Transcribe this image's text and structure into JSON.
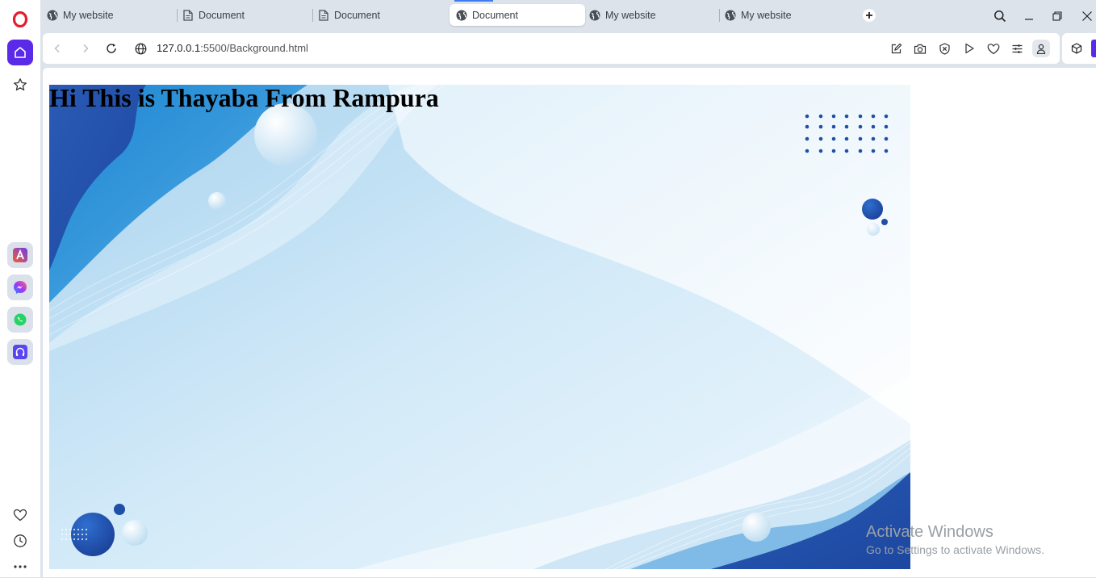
{
  "tabs": [
    {
      "label": "My website",
      "icon": "globe-icon",
      "active": false
    },
    {
      "label": "Document",
      "icon": "document-icon",
      "active": false
    },
    {
      "label": "Document",
      "icon": "document-icon",
      "active": false
    },
    {
      "label": "Document",
      "icon": "globe-icon",
      "active": true
    },
    {
      "label": "My website",
      "icon": "globe-icon",
      "active": false
    },
    {
      "label": "My website",
      "icon": "globe-icon",
      "active": false
    }
  ],
  "address_bar": {
    "host": "127.0.0.1",
    "path": ":5500/Background.html"
  },
  "page": {
    "heading": "Hi This is Thayaba From Rampura"
  },
  "watermark": {
    "title": "Activate Windows",
    "subtitle": "Go to Settings to activate Windows."
  },
  "colors": {
    "opera_red": "#e81c2d",
    "accent": "#5a2ae8",
    "wave_dark": "#1f4fa6",
    "wave_light": "#c7e3f5"
  }
}
